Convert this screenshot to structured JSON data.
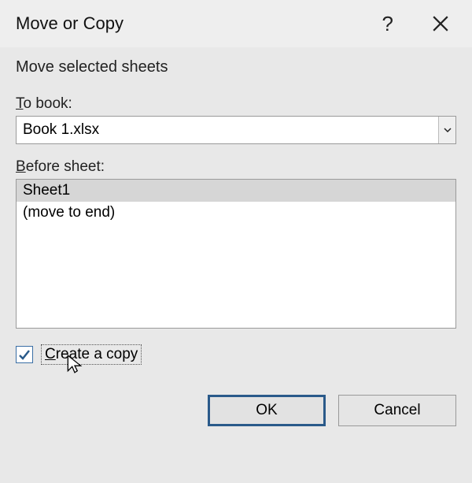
{
  "titlebar": {
    "title": "Move or Copy",
    "help_symbol": "?"
  },
  "instructions": "Move selected sheets",
  "to_book": {
    "label": "To book:",
    "value": "Book 1.xlsx"
  },
  "before_sheet": {
    "label_prefix": "B",
    "label_rest": "efore sheet:",
    "items": [
      "Sheet1",
      "(move to end)"
    ],
    "selected_index": 0
  },
  "create_copy": {
    "label_prefix": "C",
    "label_rest": "reate a copy",
    "checked": true
  },
  "buttons": {
    "ok": "OK",
    "cancel": "Cancel"
  }
}
